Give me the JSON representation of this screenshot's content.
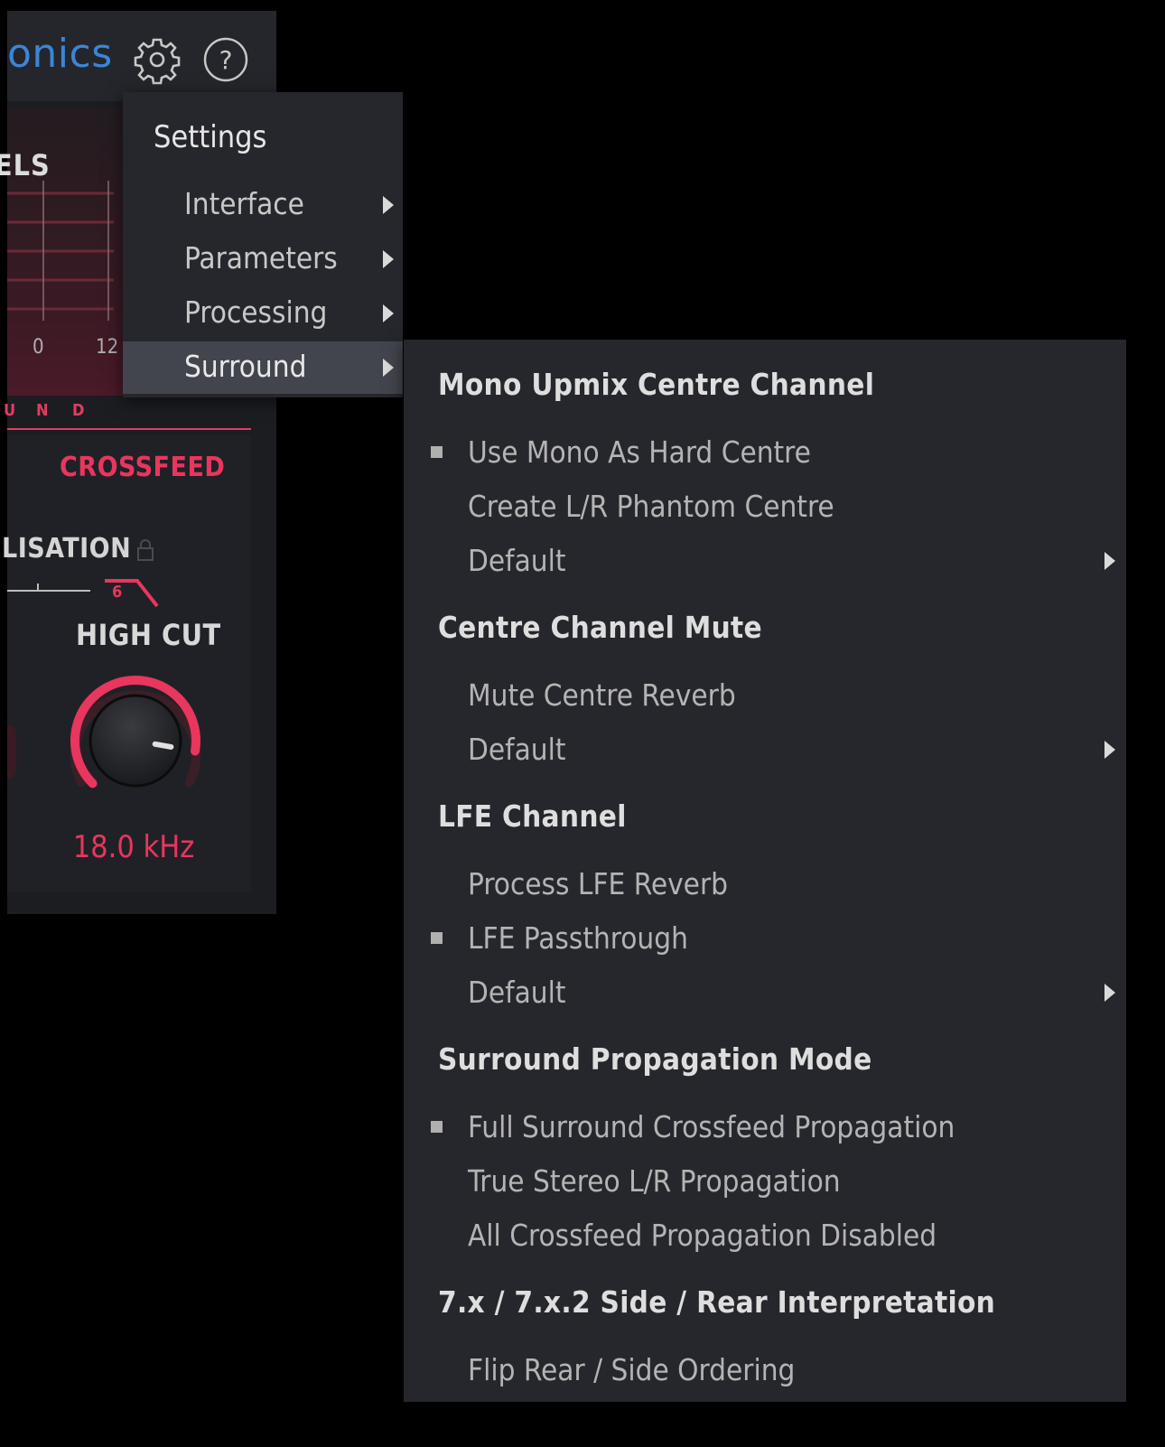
{
  "header": {
    "brand": "onics",
    "settings_icon": "gear-icon",
    "help_icon": "help-circle-icon"
  },
  "levels": {
    "title": "ELS",
    "ticks": [
      "0",
      "12"
    ]
  },
  "surround_strip": {
    "letters": [
      "U",
      "N",
      "D"
    ]
  },
  "lower": {
    "crossfeed_label": "CROSSFEED",
    "equalisation_label": "LISATION",
    "filter_order": "6",
    "high_cut_label": "HIGH CUT",
    "high_cut_value": "18.0 kHz",
    "high_cut_level": 0.87
  },
  "settings_menu": {
    "title": "Settings",
    "items": [
      {
        "label": "Interface",
        "has_submenu": true,
        "active": false
      },
      {
        "label": "Parameters",
        "has_submenu": true,
        "active": false
      },
      {
        "label": "Processing",
        "has_submenu": true,
        "active": false
      },
      {
        "label": "Surround",
        "has_submenu": true,
        "active": true
      }
    ]
  },
  "surround_menu": {
    "sections": [
      {
        "heading": "Mono Upmix Centre Channel",
        "options": [
          {
            "label": "Use Mono As Hard Centre",
            "checked": true,
            "has_submenu": false
          },
          {
            "label": "Create L/R Phantom Centre",
            "checked": false,
            "has_submenu": false
          },
          {
            "label": "Default",
            "checked": false,
            "has_submenu": true
          }
        ]
      },
      {
        "heading": "Centre Channel Mute",
        "options": [
          {
            "label": "Mute Centre Reverb",
            "checked": false,
            "has_submenu": false
          },
          {
            "label": "Default",
            "checked": false,
            "has_submenu": true
          }
        ]
      },
      {
        "heading": "LFE Channel",
        "options": [
          {
            "label": "Process LFE Reverb",
            "checked": false,
            "has_submenu": false
          },
          {
            "label": "LFE Passthrough",
            "checked": true,
            "has_submenu": false
          },
          {
            "label": "Default",
            "checked": false,
            "has_submenu": true
          }
        ]
      },
      {
        "heading": "Surround Propagation Mode",
        "options": [
          {
            "label": "Full Surround Crossfeed Propagation",
            "checked": true,
            "has_submenu": false
          },
          {
            "label": "True Stereo L/R Propagation",
            "checked": false,
            "has_submenu": false
          },
          {
            "label": "All Crossfeed Propagation Disabled",
            "checked": false,
            "has_submenu": false
          }
        ]
      },
      {
        "heading": "7.x / 7.x.2 Side / Rear Interpretation",
        "options": [
          {
            "label": "Flip Rear / Side Ordering",
            "checked": false,
            "has_submenu": false
          }
        ]
      }
    ]
  },
  "colors": {
    "accent": "#e8365e",
    "brand_blue": "#3a86d8",
    "menu_bg": "#26272c",
    "menu_highlight": "#42454d"
  }
}
